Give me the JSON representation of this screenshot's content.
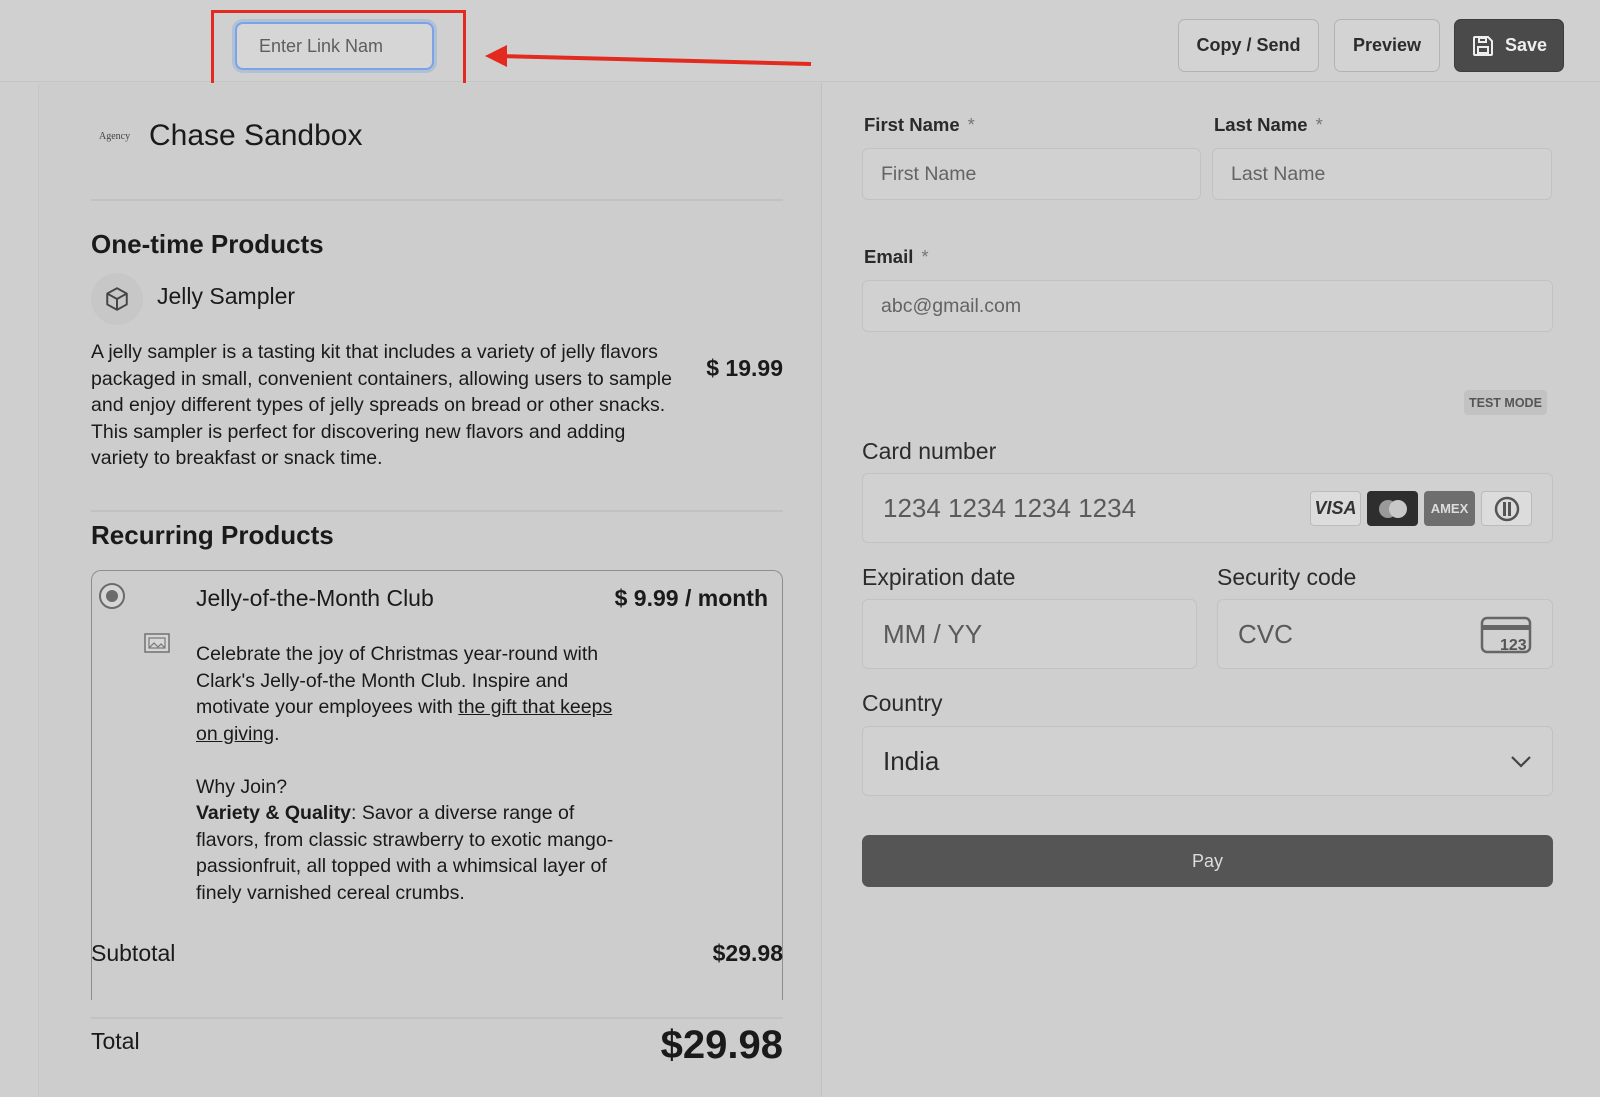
{
  "topbar": {
    "link_name_placeholder": "Enter Link Nam",
    "copy_send_label": "Copy / Send",
    "preview_label": "Preview",
    "save_label": "Save"
  },
  "annotation": {
    "highlight_color": "#e32a1f"
  },
  "brand": {
    "logo_text": "Agency",
    "name": "Chase Sandbox"
  },
  "one_time": {
    "title": "One-time Products",
    "product": {
      "name": "Jelly Sampler",
      "description": "A jelly sampler is a tasting kit that includes a variety of jelly flavors packaged in small, convenient containers, allowing users to sample and enjoy different types of jelly spreads on bread or other snacks. This sampler is perfect for discovering new flavors and adding variety to breakfast or snack time.",
      "price": "$ 19.99"
    }
  },
  "recurring": {
    "title": "Recurring Products",
    "product": {
      "name": "Jelly-of-the-Month Club",
      "price": "$ 9.99 / month",
      "desc_part1": "Celebrate the joy of Christmas year-round with Clark's Jelly-of-the Month Club. Inspire and motivate your employees with ",
      "desc_link": "the gift that keeps on giving",
      "desc_part2": ".",
      "why_join": "Why Join?",
      "variety_bold": "Variety & Quality",
      "variety_text": ": Savor a diverse range of flavors, from classic strawberry to exotic mango-passionfruit, all topped with a whimsical layer of finely varnished cereal crumbs."
    }
  },
  "summary": {
    "subtotal_label": "Subtotal",
    "subtotal_value": "$29.98",
    "total_label": "Total",
    "total_value": "$29.98"
  },
  "form": {
    "first_name_label": "First Name",
    "first_name_placeholder": "First Name",
    "last_name_label": "Last Name",
    "last_name_placeholder": "Last Name",
    "required_mark": "*",
    "email_label": "Email",
    "email_placeholder": "abc@gmail.com",
    "test_mode": "TEST MODE",
    "card_number_label": "Card number",
    "card_number_placeholder": "1234 1234 1234 1234",
    "card_brands": [
      "VISA",
      "mastercard",
      "AMEX",
      "diners"
    ],
    "expiration_label": "Expiration date",
    "expiration_placeholder": "MM / YY",
    "security_label": "Security code",
    "security_placeholder": "CVC",
    "cvc_icon_text": "123",
    "country_label": "Country",
    "country_value": "India",
    "pay_label": "Pay"
  }
}
